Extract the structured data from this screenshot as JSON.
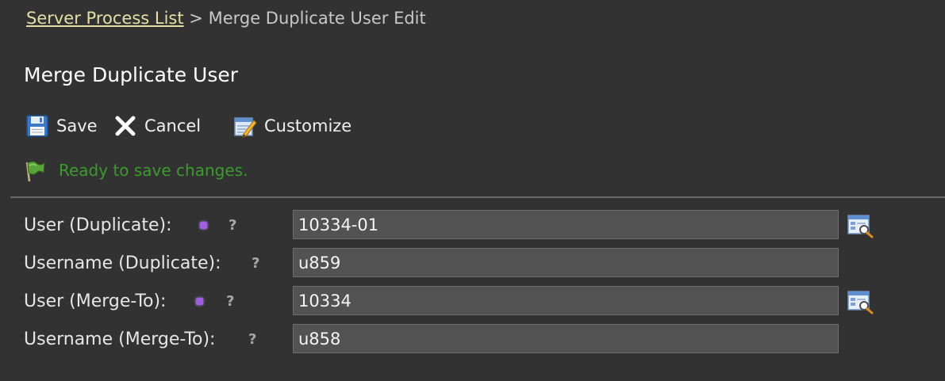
{
  "breadcrumb": {
    "parent": "Server Process List",
    "separator": ">",
    "current": "Merge Duplicate User Edit"
  },
  "page": {
    "title": "Merge Duplicate User"
  },
  "toolbar": {
    "save_label": "Save",
    "cancel_label": "Cancel",
    "customize_label": "Customize"
  },
  "status": {
    "message": "Ready to save changes.",
    "color": "#3d9a2f"
  },
  "form": {
    "rows": [
      {
        "label": "User (Duplicate):",
        "value": "10334-01",
        "required": true,
        "lookup": true
      },
      {
        "label": "Username (Duplicate):",
        "value": "u859",
        "required": false,
        "lookup": false
      },
      {
        "label": "User (Merge-To):",
        "value": "10334",
        "required": true,
        "lookup": true
      },
      {
        "label": "Username (Merge-To):",
        "value": "u858",
        "required": false,
        "lookup": false
      }
    ],
    "help_glyph": "?"
  },
  "colors": {
    "background": "#323232",
    "link": "#e2e0a6",
    "required_marker": "#a05ee0"
  },
  "icons": {
    "save": "floppy-disk-icon",
    "cancel": "close-x-icon",
    "customize": "edit-form-icon",
    "status": "flag-icon",
    "lookup": "lookup-search-icon"
  }
}
